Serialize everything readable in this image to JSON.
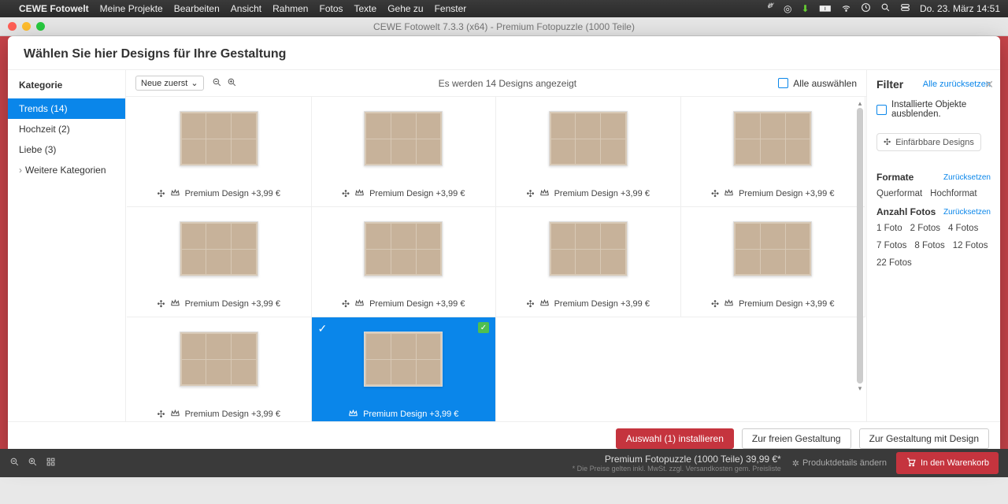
{
  "menubar": {
    "app": "CEWE Fotowelt",
    "items": [
      "Meine Projekte",
      "Bearbeiten",
      "Ansicht",
      "Rahmen",
      "Fotos",
      "Texte",
      "Gehe zu",
      "Fenster"
    ],
    "datetime": "Do. 23. März  14:51"
  },
  "window": {
    "title": "CEWE Fotowelt 7.3.3 (x64) - Premium Fotopuzzle (1000 Teile)"
  },
  "modal": {
    "header": "Wählen Sie hier Designs für Ihre Gestaltung",
    "sidebar": {
      "heading": "Kategorie",
      "items": [
        {
          "label": "Trends (14)",
          "active": true
        },
        {
          "label": "Hochzeit (2)",
          "active": false
        },
        {
          "label": "Liebe (3)",
          "active": false
        },
        {
          "label": "Weitere Kategorien",
          "active": false,
          "expand": true
        }
      ]
    },
    "toolbar": {
      "sort": "Neue zuerst",
      "count": "Es werden 14 Designs angezeigt",
      "selectall": "Alle auswählen"
    },
    "tile_label": "Premium Design +3,99 €",
    "tiles": [
      {
        "selected": false
      },
      {
        "selected": false
      },
      {
        "selected": false
      },
      {
        "selected": false
      },
      {
        "selected": false
      },
      {
        "selected": false
      },
      {
        "selected": false
      },
      {
        "selected": false
      },
      {
        "selected": false
      },
      {
        "selected": true
      }
    ],
    "filter": {
      "title": "Filter",
      "reset_all": "Alle zurücksetzen",
      "hide_installed": "Installierte Objekte ausblenden.",
      "colorable": "Einfärbbare Designs",
      "formats": {
        "heading": "Formate",
        "reset": "Zurücksetzen",
        "options": [
          "Querformat",
          "Hochformat"
        ]
      },
      "photos": {
        "heading": "Anzahl Fotos",
        "reset": "Zurücksetzen",
        "options": [
          "1 Foto",
          "2 Fotos",
          "4 Fotos",
          "7 Fotos",
          "8 Fotos",
          "12 Fotos",
          "22 Fotos"
        ]
      }
    },
    "footer": {
      "install": "Auswahl (1) installieren",
      "free": "Zur freien Gestaltung",
      "design": "Zur Gestaltung mit Design"
    }
  },
  "bottombar": {
    "price": "Premium Fotopuzzle (1000 Teile) 39,99 €*",
    "note": "* Die Preise gelten inkl. MwSt. zzgl. Versandkosten gem. Preisliste",
    "details": "Produktdetails ändern",
    "cart": "In den Warenkorb"
  }
}
